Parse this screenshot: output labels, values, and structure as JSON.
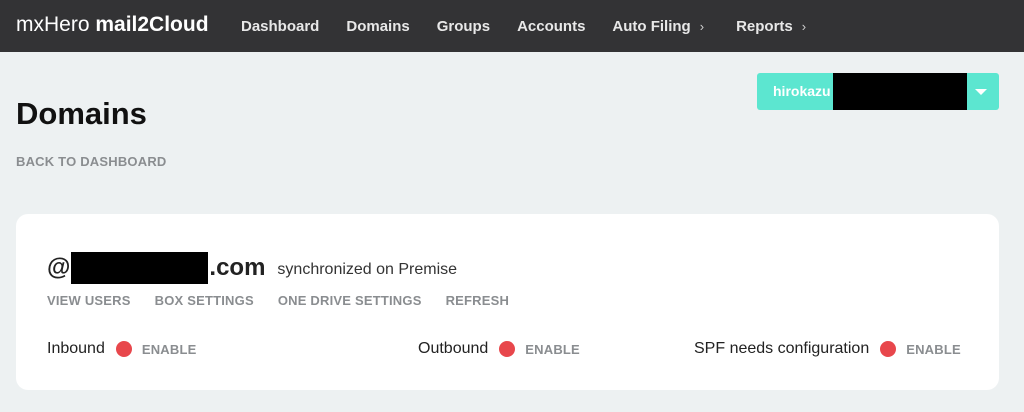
{
  "brand": {
    "prefix": "mxHero",
    "product": "mail2Cloud"
  },
  "nav": {
    "items": [
      {
        "label": "Dashboard"
      },
      {
        "label": "Domains"
      },
      {
        "label": "Groups"
      },
      {
        "label": "Accounts"
      },
      {
        "label": "Auto Filing",
        "chevron": "›"
      },
      {
        "label": "Reports",
        "chevron": "›"
      }
    ]
  },
  "user": {
    "name": "hirokazu"
  },
  "page": {
    "title": "Domains",
    "back_label": "BACK TO DASHBOARD"
  },
  "domain": {
    "prefix": "@",
    "suffix": ".com",
    "sync_status": "synchronized on Premise",
    "actions": [
      "VIEW USERS",
      "BOX SETTINGS",
      "ONE DRIVE SETTINGS",
      "REFRESH"
    ],
    "statuses": [
      {
        "label": "Inbound",
        "action": "ENABLE"
      },
      {
        "label": "Outbound",
        "action": "ENABLE"
      },
      {
        "label": "SPF needs configuration",
        "action": "ENABLE"
      }
    ]
  },
  "colors": {
    "topbar": "#333335",
    "accent": "#5ce6d0",
    "status_off": "#e8474c",
    "background": "#edf1f2"
  }
}
